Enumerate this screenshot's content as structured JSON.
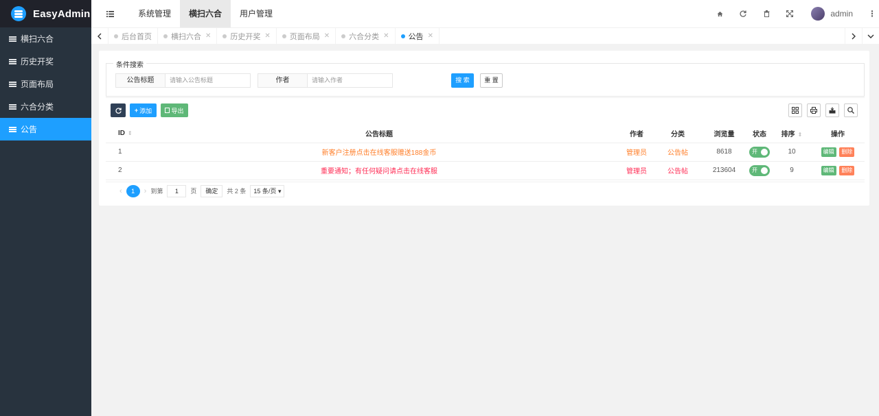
{
  "app": {
    "name": "EasyAdmin"
  },
  "sidebar": {
    "items": [
      {
        "label": "横扫六合",
        "active": false
      },
      {
        "label": "历史开奖",
        "active": false
      },
      {
        "label": "页面布局",
        "active": false
      },
      {
        "label": "六合分类",
        "active": false
      },
      {
        "label": "公告",
        "active": true
      }
    ]
  },
  "header": {
    "tabs": [
      {
        "label": "系统管理"
      },
      {
        "label": "横扫六合",
        "active": true
      },
      {
        "label": "用户管理"
      }
    ],
    "user": "admin"
  },
  "tabbar": {
    "tabs": [
      {
        "label": "后台首页",
        "closable": false
      },
      {
        "label": "横扫六合",
        "closable": true
      },
      {
        "label": "历史开奖",
        "closable": true
      },
      {
        "label": "页面布局",
        "closable": true
      },
      {
        "label": "六合分类",
        "closable": true
      },
      {
        "label": "公告",
        "closable": true,
        "active": true
      }
    ]
  },
  "search": {
    "legend": "条件搜索",
    "title_label": "公告标题",
    "title_placeholder": "请输入公告标题",
    "author_label": "作者",
    "author_placeholder": "请输入作者",
    "search_btn": "搜 索",
    "reset_btn": "重 置"
  },
  "toolbar": {
    "add": "添加",
    "export": "导出"
  },
  "table": {
    "headers": {
      "id": "ID",
      "title": "公告标题",
      "author": "作者",
      "category": "分类",
      "views": "浏览量",
      "status": "状态",
      "sort": "排序",
      "ops": "操作"
    },
    "rows": [
      {
        "id": "1",
        "title": "新客户注册点击在线客服赠送188金币",
        "title_color": "#ff7f2a",
        "author": "管理员",
        "category": "公告帖",
        "views": "8618",
        "status": "开",
        "sort": "10",
        "edit": "编辑",
        "delete": "删除"
      },
      {
        "id": "2",
        "title": "重要通知；有任何疑问请点击在线客服",
        "title_color": "#ff2d55",
        "author": "管理员",
        "category": "公告帖",
        "views": "213604",
        "status": "开",
        "sort": "9",
        "edit": "编辑",
        "delete": "删除"
      }
    ]
  },
  "pager": {
    "current": "1",
    "goto_label": "到第",
    "goto_value": "1",
    "page_unit": "页",
    "confirm": "确定",
    "total": "共 2 条",
    "page_size": "15 条/页"
  }
}
